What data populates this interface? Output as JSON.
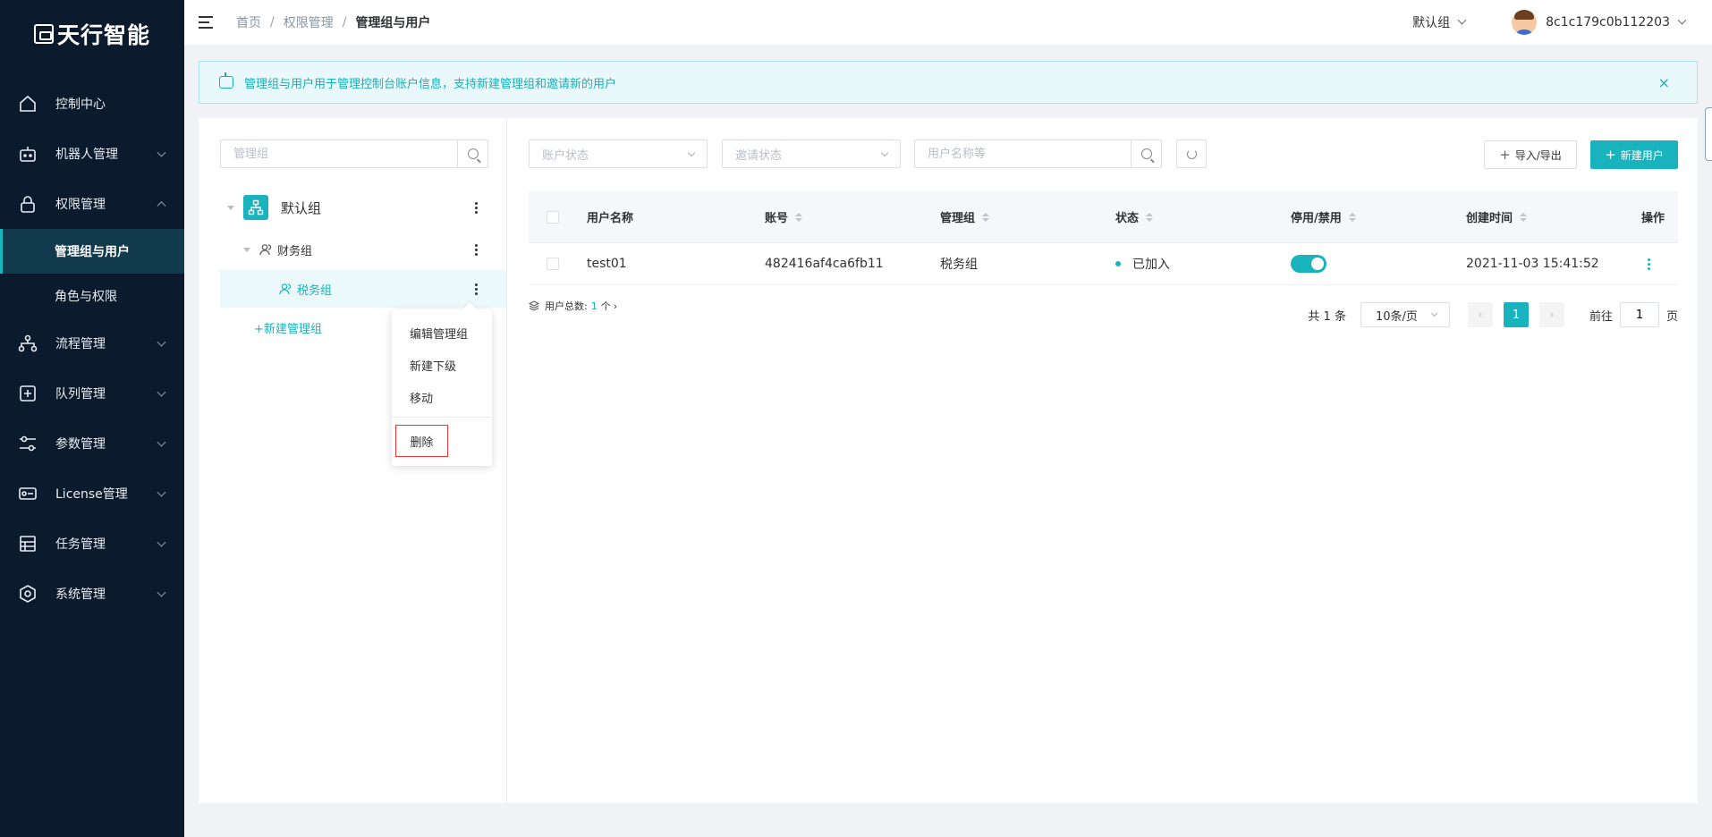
{
  "brand": {
    "name": "天行智能"
  },
  "sidebar": {
    "items": [
      {
        "label": "控制中心",
        "icon": "home-icon",
        "has_arrow": false
      },
      {
        "label": "机器人管理",
        "icon": "robot-icon",
        "has_arrow": true
      },
      {
        "label": "权限管理",
        "icon": "lock-icon",
        "has_arrow": true,
        "expanded": true,
        "children": [
          {
            "label": "管理组与用户",
            "active": true
          },
          {
            "label": "角色与权限",
            "active": false
          }
        ]
      },
      {
        "label": "流程管理",
        "icon": "flow-icon",
        "has_arrow": true
      },
      {
        "label": "队列管理",
        "icon": "queue-icon",
        "has_arrow": true
      },
      {
        "label": "参数管理",
        "icon": "sliders-icon",
        "has_arrow": true
      },
      {
        "label": "License管理",
        "icon": "license-icon",
        "has_arrow": true
      },
      {
        "label": "任务管理",
        "icon": "task-icon",
        "has_arrow": true
      },
      {
        "label": "系统管理",
        "icon": "settings-hex-icon",
        "has_arrow": true
      }
    ]
  },
  "header": {
    "breadcrumb": [
      "首页",
      "权限管理",
      "管理组与用户"
    ],
    "group_select": "默认组",
    "user_name": "8c1c179c0b112203"
  },
  "alert": {
    "text": "管理组与用户用于管理控制台账户信息，支持新建管理组和邀请新的用户",
    "close": "×"
  },
  "tree": {
    "search_placeholder": "管理组",
    "root": {
      "label": "默认组"
    },
    "nodes": [
      {
        "label": "财务组"
      },
      {
        "label": "税务组",
        "selected": true
      }
    ],
    "add_group": "+新建管理组",
    "context_menu": {
      "items": [
        "编辑管理组",
        "新建下级",
        "移动"
      ],
      "delete": "删除"
    }
  },
  "filters": {
    "account_status_placeholder": "账户状态",
    "invite_status_placeholder": "邀请状态",
    "user_search_placeholder": "用户名称等",
    "import_export": "导入/导出",
    "new_user": "新建用户"
  },
  "table": {
    "columns": [
      "用户名称",
      "账号",
      "管理组",
      "状态",
      "停用/禁用",
      "创建时间",
      "操作"
    ],
    "rows": [
      {
        "name": "test01",
        "account": "482416af4ca6fb11",
        "group": "税务组",
        "status": "已加入",
        "enabled": true,
        "created": "2021-11-03 15:41:52"
      }
    ]
  },
  "summary": {
    "label": "用户总数:",
    "count": "1",
    "unit": "个"
  },
  "pagination": {
    "total": "共 1 条",
    "page_size": "10条/页",
    "current_page": "1",
    "goto_label": "前往",
    "goto_value": "1",
    "goto_suffix": "页"
  },
  "colors": {
    "accent": "#19b3bd",
    "sidebar_bg": "#0b1a2c",
    "active_menu_bg": "#113a4c",
    "danger_border": "#e53935"
  }
}
